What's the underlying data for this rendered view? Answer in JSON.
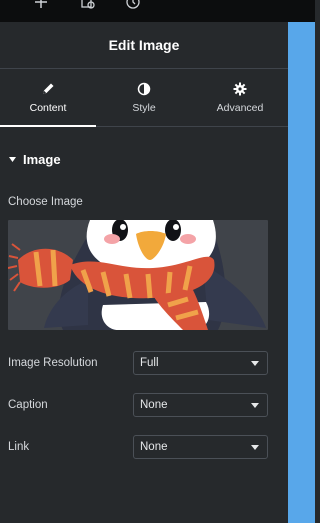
{
  "header": {
    "title": "Edit Image"
  },
  "tabs": [
    {
      "label": "Content",
      "icon": "pencil-icon",
      "active": true
    },
    {
      "label": "Style",
      "icon": "half-circle-icon",
      "active": false
    },
    {
      "label": "Advanced",
      "icon": "gear-icon",
      "active": false
    }
  ],
  "section": {
    "title": "Image"
  },
  "choose_image": {
    "label": "Choose Image"
  },
  "fields": [
    {
      "label": "Image Resolution",
      "value": "Full"
    },
    {
      "label": "Caption",
      "value": "None"
    },
    {
      "label": "Link",
      "value": "None"
    }
  ],
  "colors": {
    "panel_bg": "#26292c",
    "topbar_bg": "#0c0d0e",
    "canvas_accent": "#58a7ea",
    "divider": "#3f444b"
  }
}
